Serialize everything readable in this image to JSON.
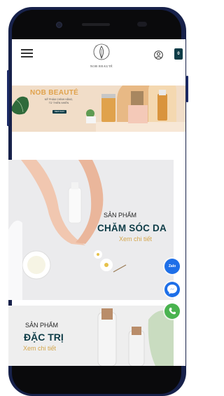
{
  "header": {
    "logo_text": "NOB BEAUTÉ",
    "cart_count": "0"
  },
  "banner": {
    "title": "NOB BEAUTÉ",
    "subtitle": "MỸ PHẨM CHÍNH HÃNG,\nTỪ THIÊN NHIÊN",
    "button_label": "XEM NGAY"
  },
  "category_cards": [
    {
      "pre_label": "SẢN PHẨM",
      "title": "CHĂM SÓC DA",
      "link": "Xem chi tiết"
    },
    {
      "pre_label": "SẢN PHẨM",
      "title": "ĐẶC TRỊ",
      "link": "Xem chi tiết"
    }
  ],
  "floating_actions": {
    "zalo_label": "Zalo"
  },
  "colors": {
    "brand_teal": "#0d3c47",
    "accent_gold": "#d4a64c",
    "phone_frame": "#17214a",
    "zalo_blue": "#1e6fe8",
    "call_green": "#49b34f"
  }
}
